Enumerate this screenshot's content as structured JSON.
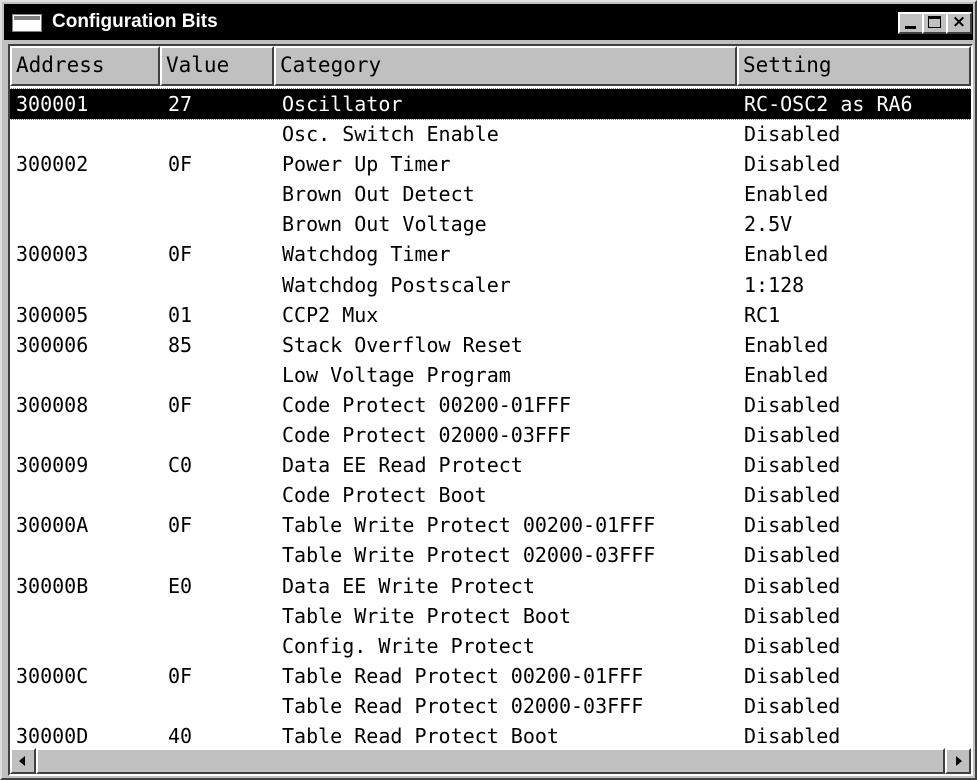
{
  "window": {
    "title": "Configuration Bits",
    "title_icon": "window-app-icon",
    "controls": {
      "minimize": "minimize-icon",
      "maximize": "maximize-icon",
      "close": "close-icon",
      "close_glyph": "×"
    }
  },
  "table": {
    "columns": [
      "Address",
      "Value",
      "Category",
      "Setting"
    ],
    "selected_row": 0,
    "rows": [
      {
        "address": "300001",
        "value": "27",
        "category": "Oscillator",
        "setting": "RC-OSC2 as RA6"
      },
      {
        "address": "",
        "value": "",
        "category": "Osc. Switch Enable",
        "setting": "Disabled"
      },
      {
        "address": "300002",
        "value": "0F",
        "category": "Power Up Timer",
        "setting": "Disabled"
      },
      {
        "address": "",
        "value": "",
        "category": "Brown Out Detect",
        "setting": "Enabled"
      },
      {
        "address": "",
        "value": "",
        "category": "Brown Out Voltage",
        "setting": "2.5V"
      },
      {
        "address": "300003",
        "value": "0F",
        "category": "Watchdog Timer",
        "setting": "Enabled"
      },
      {
        "address": "",
        "value": "",
        "category": "Watchdog Postscaler",
        "setting": "1:128"
      },
      {
        "address": "300005",
        "value": "01",
        "category": "CCP2 Mux",
        "setting": "RC1"
      },
      {
        "address": "300006",
        "value": "85",
        "category": "Stack Overflow Reset",
        "setting": "Enabled"
      },
      {
        "address": "",
        "value": "",
        "category": "Low Voltage Program",
        "setting": "Enabled"
      },
      {
        "address": "300008",
        "value": "0F",
        "category": "Code Protect 00200-01FFF",
        "setting": "Disabled"
      },
      {
        "address": "",
        "value": "",
        "category": "Code Protect 02000-03FFF",
        "setting": "Disabled"
      },
      {
        "address": "300009",
        "value": "C0",
        "category": "Data EE Read Protect",
        "setting": "Disabled"
      },
      {
        "address": "",
        "value": "",
        "category": "Code Protect Boot",
        "setting": "Disabled"
      },
      {
        "address": "30000A",
        "value": "0F",
        "category": "Table Write Protect 00200-01FFF",
        "setting": "Disabled"
      },
      {
        "address": "",
        "value": "",
        "category": "Table Write Protect 02000-03FFF",
        "setting": "Disabled"
      },
      {
        "address": "30000B",
        "value": "E0",
        "category": "Data EE Write Protect",
        "setting": "Disabled"
      },
      {
        "address": "",
        "value": "",
        "category": "Table Write Protect Boot",
        "setting": "Disabled"
      },
      {
        "address": "",
        "value": "",
        "category": "Config. Write Protect",
        "setting": "Disabled"
      },
      {
        "address": "30000C",
        "value": "0F",
        "category": "Table Read Protect 00200-01FFF",
        "setting": "Disabled"
      },
      {
        "address": "",
        "value": "",
        "category": "Table Read Protect 02000-03FFF",
        "setting": "Disabled"
      },
      {
        "address": "30000D",
        "value": "40",
        "category": "Table Read Protect Boot",
        "setting": "Disabled"
      }
    ]
  },
  "scrollbar": {
    "left_arrow": "scroll-left-arrow-icon",
    "right_arrow": "scroll-right-arrow-icon"
  },
  "colors": {
    "titlebar": "#000000",
    "face": "#c0c0c0",
    "selection_bg": "#000000",
    "selection_fg": "#ffffff"
  }
}
